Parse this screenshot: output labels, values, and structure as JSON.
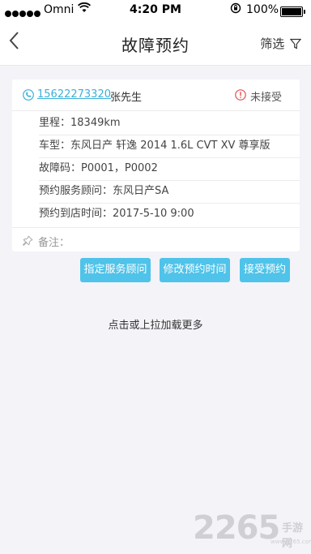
{
  "status_bar": {
    "carrier": "Omni",
    "time": "4:20 PM",
    "battery": "100%"
  },
  "nav": {
    "title": "故障预约",
    "filter_label": "筛选"
  },
  "appointment": {
    "phone": "15622273320",
    "customer": "张先生",
    "status": "未接受",
    "mileage": "里程：18349km",
    "model": "车型：东风日产 轩逸 2014 1.6L CVT XV 尊享版",
    "fault_codes": "故障码：P0001，P0002",
    "advisor": "预约服务顾问：东风日产SA",
    "arrival_time": "预约到店时间：2017-5-10 9:00",
    "note_label": "备注："
  },
  "actions": {
    "assign_label": "指定服务顾问",
    "modify_label": "修改预约时间",
    "accept_label": "接受预约"
  },
  "load_more": "点击或上拉加载更多",
  "watermark": {
    "number": "2265",
    "site": "手游网",
    "url": "www.2265.com"
  },
  "colors": {
    "accent": "#4fc3e9",
    "link": "#3ab0d8",
    "alert": "#e54d4d",
    "background": "#f4f3f8"
  }
}
